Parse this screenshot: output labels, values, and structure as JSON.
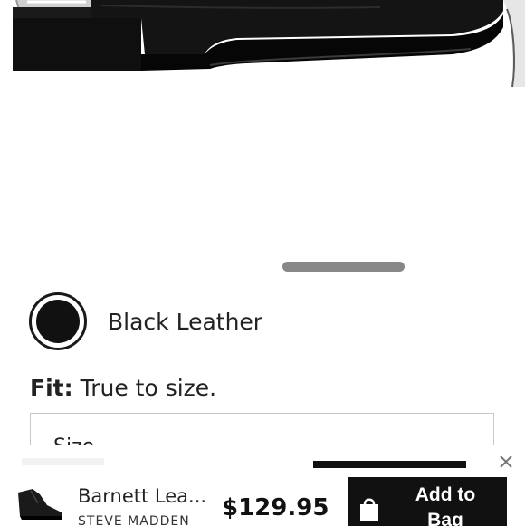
{
  "product": {
    "image_alt": "Black leather bootie with silver heel",
    "color_name": "Black Leather",
    "color_hex": "#111111",
    "fit_label": "Fit:",
    "fit_value": "True to size.",
    "size_label": "Size"
  },
  "sticky_bar": {
    "title": "Barnett Lea...",
    "brand": "STEVE MADDEN",
    "price": "$129.95",
    "add_to_bag_label": "Add to Bag",
    "close_icon": "close-icon",
    "bag_icon": "shopping-bag-icon"
  },
  "colors": {
    "accent": "#111111",
    "indicator": "#888888"
  }
}
